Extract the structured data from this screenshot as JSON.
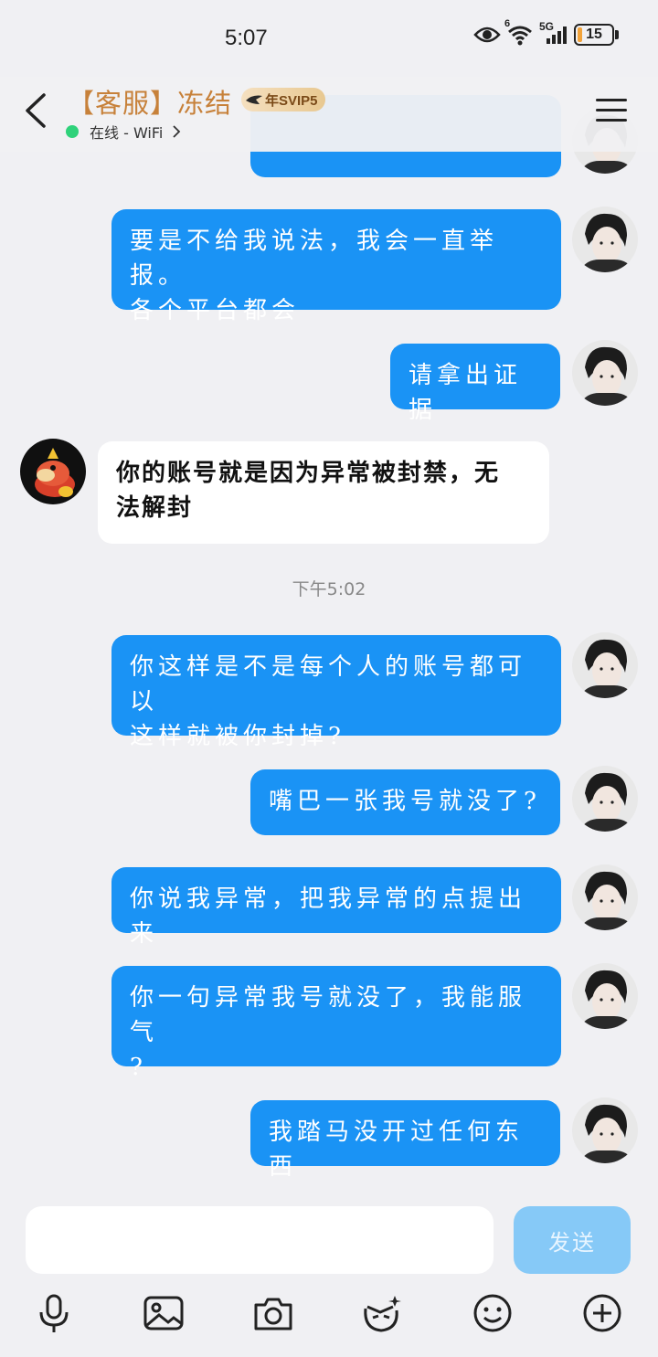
{
  "status_bar": {
    "time": "5:07",
    "network_label": "5G",
    "wifi_label": "6",
    "battery_level": 15,
    "battery_text": "15"
  },
  "header": {
    "name": "【客服】冻结",
    "vip_label": "年SVIP5",
    "online_status": "在线 - WiFi"
  },
  "messages": [
    {
      "side": "out",
      "lines": [
        "要是不给我说法，我会一直举报。",
        "各个平台都会"
      ]
    },
    {
      "side": "out",
      "lines": [
        "请拿出证据"
      ]
    },
    {
      "side": "in",
      "lines": [
        "你的账号就是因为异常被封禁，无",
        "法解封"
      ]
    },
    {
      "side": "out",
      "lines": [
        "你这样是不是每个人的账号都可以",
        "这样就被你封掉?"
      ]
    },
    {
      "side": "out",
      "lines": [
        "嘴巴一张我号就没了?"
      ]
    },
    {
      "side": "out",
      "lines": [
        "你说我异常，把我异常的点提出来"
      ]
    },
    {
      "side": "out",
      "lines": [
        "你一句异常我号就没了，我能服气",
        "?"
      ]
    },
    {
      "side": "out",
      "lines": [
        "我踏马没开过任何东西"
      ]
    }
  ],
  "timestamp": "下午5:02",
  "composer": {
    "input_value": "",
    "send_label": "发送"
  },
  "colors": {
    "bubble_out": "#1a93f5",
    "bubble_in": "#ffffff",
    "name_gold": "#c7813a",
    "online_green": "#2fd27a",
    "send_disabled": "#86c9f7"
  },
  "toolbar_icons": [
    "microphone-icon",
    "image-icon",
    "camera-icon",
    "sticker-icon",
    "emoji-icon",
    "plus-icon"
  ]
}
